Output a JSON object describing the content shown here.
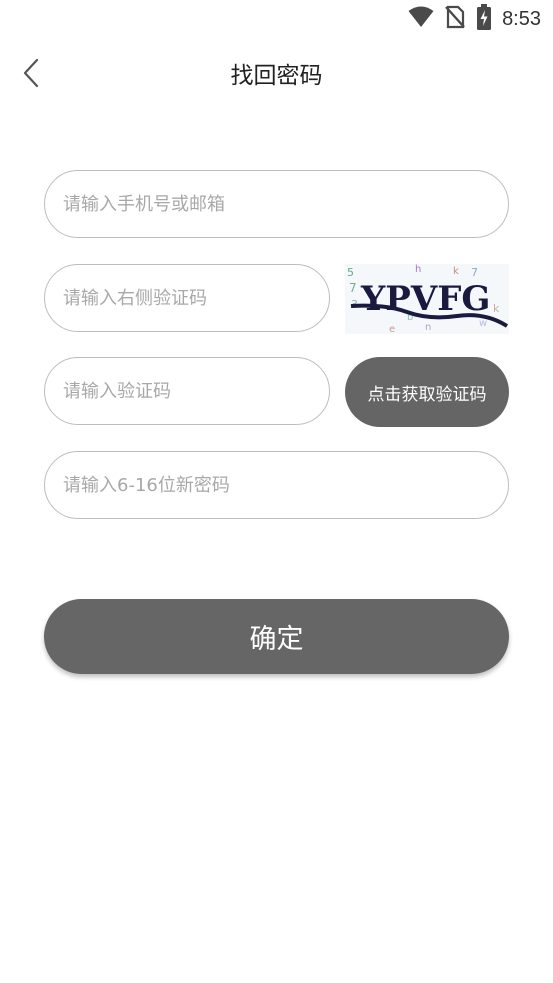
{
  "status_bar": {
    "time": "8:53",
    "icons": [
      "wifi-icon",
      "no-sim-icon",
      "battery-charging-icon"
    ]
  },
  "nav": {
    "title": "找回密码",
    "back_icon": "chevron-left-icon"
  },
  "form": {
    "account_placeholder": "请输入手机号或邮箱",
    "captcha_placeholder": "请输入右侧验证码",
    "captcha_text": "YPVFG",
    "sms_code_placeholder": "请输入验证码",
    "get_code_label": "点击获取验证码",
    "new_password_placeholder": "请输入6-16位新密码",
    "confirm_label": "确定"
  },
  "colors": {
    "button_bg": "#666666",
    "field_border": "#bdbdbd",
    "placeholder": "#a8a8a8"
  }
}
